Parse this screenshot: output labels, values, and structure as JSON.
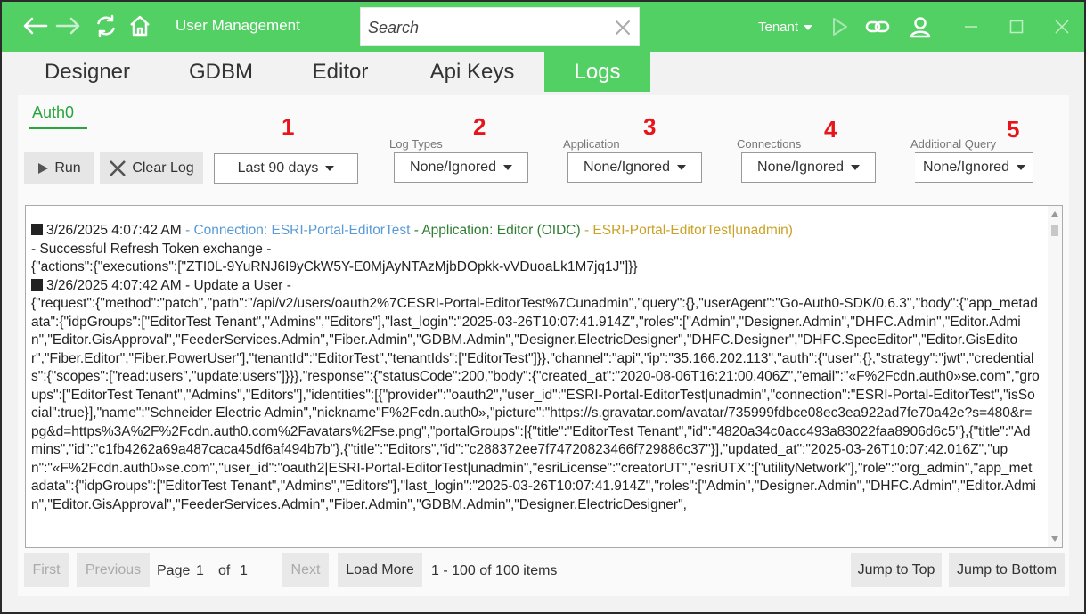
{
  "titlebar": {
    "app_title": "User Management",
    "search_placeholder": "Search",
    "tenant_label": "Tenant"
  },
  "tabs": [
    {
      "label": "Designer"
    },
    {
      "label": "GDBM"
    },
    {
      "label": "Editor"
    },
    {
      "label": "Api Keys"
    },
    {
      "label": "Logs"
    }
  ],
  "subtab": "Auth0",
  "toolbar": {
    "run_label": "Run",
    "clear_label": "Clear Log",
    "range_value": "Last 90 days"
  },
  "filters": [
    {
      "number": "1"
    },
    {
      "number": "2",
      "label": "Log Types",
      "value": "None/Ignored"
    },
    {
      "number": "3",
      "label": "Application",
      "value": "None/Ignored"
    },
    {
      "number": "4",
      "label": "Connections",
      "value": "None/Ignored"
    },
    {
      "number": "5",
      "label": "Additional Query",
      "value": "None/Ignored"
    }
  ],
  "log": {
    "e1_time": "3/26/2025 4:07:42 AM",
    "e1_connection": " - Connection: ESRI-Portal-EditorTest",
    "e1_application": " - Application: Editor (OIDC)",
    "e1_user": " - ESRI-Portal-EditorTest|unadmin)",
    "e1_desc": "- Successful Refresh Token exchange -",
    "e1_json": "{\"actions\":{\"executions\":[\"ZTI0L-9YuRNJ6I9yCkW5Y-E0MjAyNTAzMjbDOpkk-vVDuoaLk1M7jq1J\"]}}",
    "e2_time": "3/26/2025 4:07:42 AM",
    "e2_desc": " - Update a User -",
    "e2_json": "{\"request\":{\"method\":\"patch\",\"path\":\"/api/v2/users/oauth2%7CESRI-Portal-EditorTest%7Cunadmin\",\"query\":{},\"userAgent\":\"Go-Auth0-SDK/0.6.3\",\"body\":{\"app_metadata\":{\"idpGroups\":[\"EditorTest Tenant\",\"Admins\",\"Editors\"],\"last_login\":\"2025-03-26T10:07:41.914Z\",\"roles\":[\"Admin\",\"Designer.Admin\",\"DHFC.Admin\",\"Editor.Admin\",\"Editor.GisApproval\",\"FeederServices.Admin\",\"Fiber.Admin\",\"GDBM.Admin\",\"Designer.ElectricDesigner\",\"DHFC.Designer\",\"DHFC.SpecEditor\",\"Editor.GisEditor\",\"Fiber.Editor\",\"Fiber.PowerUser\"],\"tenantId\":\"EditorTest\",\"tenantIds\":[\"EditorTest\"]}},\"channel\":\"api\",\"ip\":\"35.166.202.113\",\"auth\":{\"user\":{},\"strategy\":\"jwt\",\"credentials\":{\"scopes\":[\"read:users\",\"update:users\"]}}},\"response\":{\"statusCode\":200,\"body\":{\"created_at\":\"2020-08-06T16:21:00.406Z\",\"email\":\"«F%2Fcdn.auth0»se.com\",\"groups\":[\"EditorTest Tenant\",\"Admins\",\"Editors\"],\"identities\":[{\"provider\":\"oauth2\",\"user_id\":\"ESRI-Portal-EditorTest|unadmin\",\"connection\":\"ESRI-Portal-EditorTest\",\"isSocial\":true}],\"name\":\"Schneider Electric Admin\",\"nickname\"F%2Fcdn.auth0»,\"picture\":\"https://s.gravatar.com/avatar/735999fdbce08ec3ea922ad7fe70a42e?s=480&r=pg&d=https%3A%2F%2Fcdn.auth0.com%2Favatars%2Fse.png\",\"portalGroups\":[{\"title\":\"EditorTest Tenant\",\"id\":\"4820a34c0acc493a83022faa8906d6c5\"},{\"title\":\"Admins\",\"id\":\"c1fb4262a69a487caca45df6af494b7b\"},{\"title\":\"Editors\",\"id\":\"c288372ee7f74720823466f729886c37\"}],\"updated_at\":\"2025-03-26T10:07:42.016Z\",\"upn\":\"«F%2Fcdn.auth0»se.com\",\"user_id\":\"oauth2|ESRI-Portal-EditorTest|unadmin\",\"esriLicense\":\"creatorUT\",\"esriUTX\":[\"utilityNetwork\"],\"role\":\"org_admin\",\"app_metadata\":{\"idpGroups\":[\"EditorTest Tenant\",\"Admins\",\"Editors\"],\"last_login\":\"2025-03-26T10:07:41.914Z\",\"roles\":[\"Admin\",\"Designer.Admin\",\"DHFC.Admin\",\"Editor.Admin\",\"Editor.GisApproval\",\"FeederServices.Admin\",\"Fiber.Admin\",\"GDBM.Admin\",\"Designer.ElectricDesigner\","
  },
  "pager": {
    "first": "First",
    "previous": "Previous",
    "page_word": "Page",
    "page_num": "1",
    "of_word": "of",
    "total_pages": "1",
    "next": "Next",
    "load_more": "Load More",
    "items_summary": "1 - 100 of 100 items",
    "jump_top": "Jump to Top",
    "jump_bottom": "Jump to Bottom"
  },
  "colors": {
    "accent": "#52d064",
    "active_subtab": "#27a63a",
    "annotation_red": "#e8141b",
    "connection_blue": "#5b9bd5",
    "application_green": "#2e7d32",
    "user_gold": "#c9a227"
  },
  "icons": {
    "back": "arrow-left-icon",
    "forward": "arrow-right-icon",
    "refresh": "refresh-icon",
    "home": "home-icon",
    "play": "play-icon",
    "link": "link-icon",
    "user": "user-icon"
  }
}
